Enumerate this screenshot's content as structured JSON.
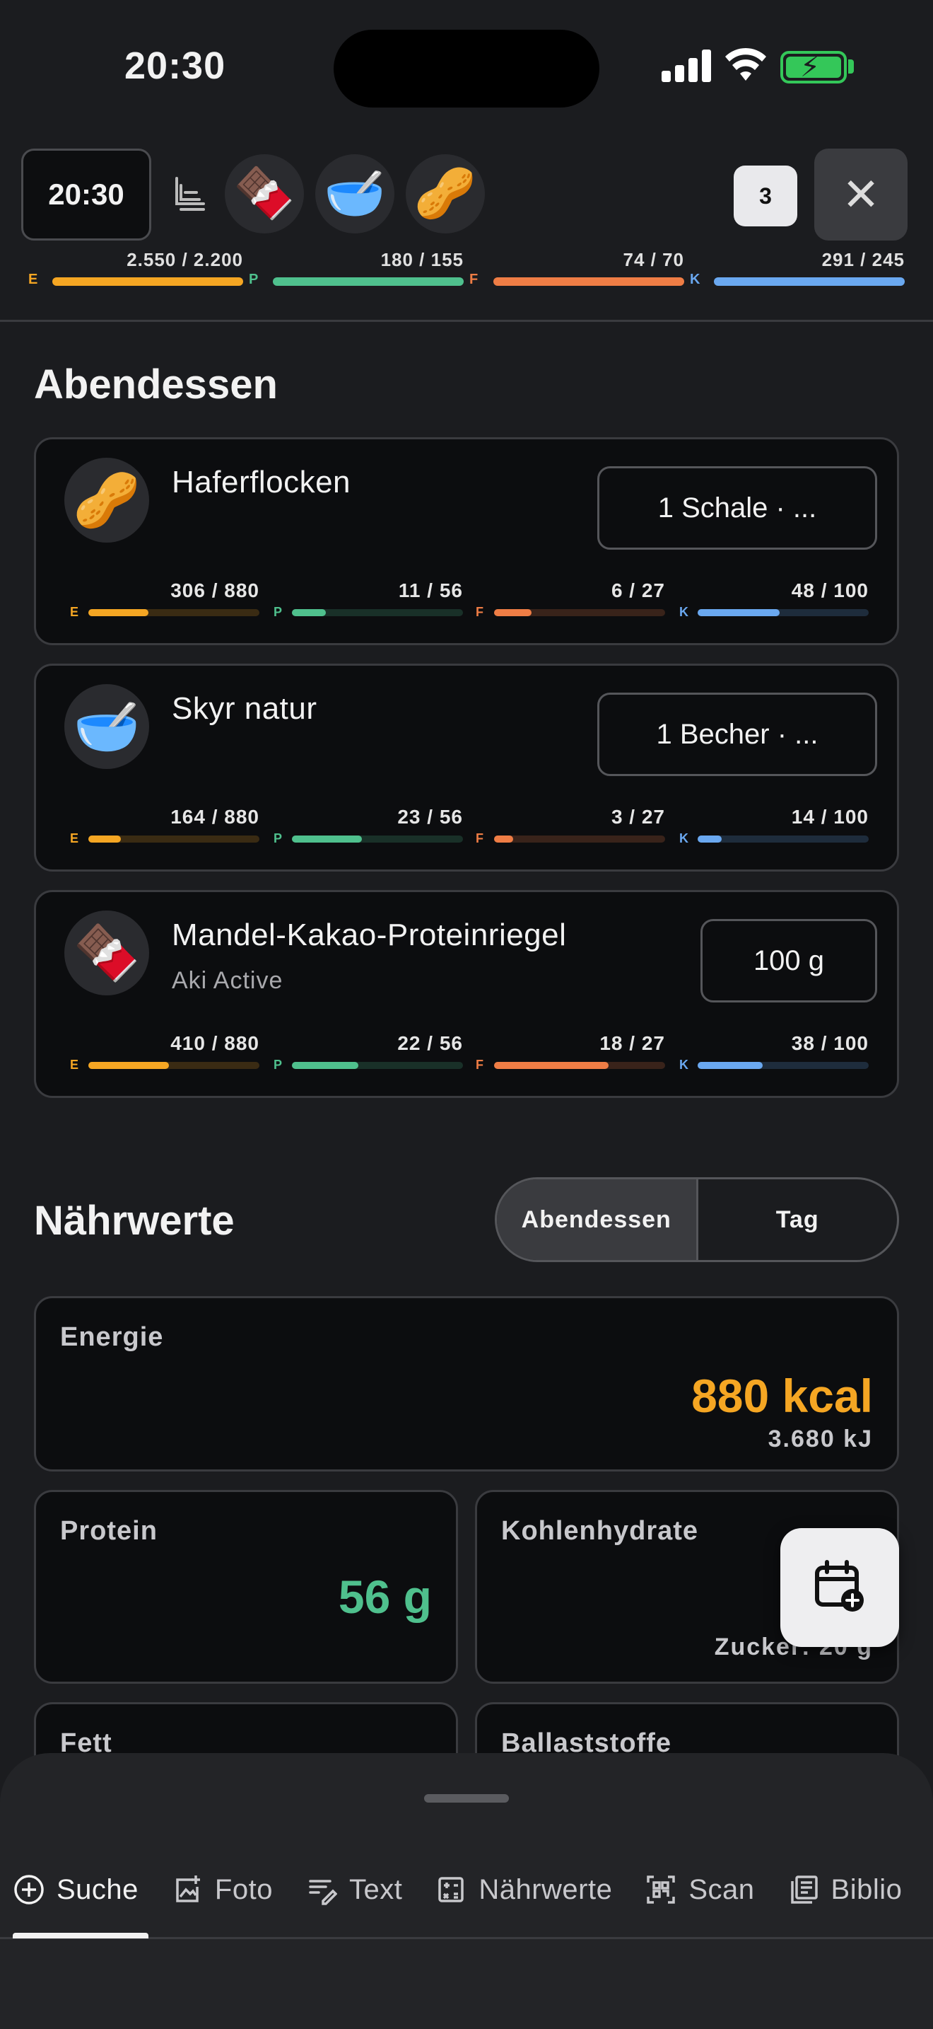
{
  "status_bar": {
    "time": "20:30"
  },
  "header": {
    "time_chip": "20:30",
    "item_count": "3",
    "thumbs": [
      "🍫",
      "🥣",
      "🥜"
    ],
    "bars": [
      {
        "letter": "E",
        "value": "2.550 / 2.200",
        "fraction": 1.0,
        "color": "#f5a623",
        "track": "#f5a623"
      },
      {
        "letter": "P",
        "value": "180 / 155",
        "fraction": 1.0,
        "color": "#4fc08d",
        "track": "#4fc08d"
      },
      {
        "letter": "F",
        "value": "74 / 70",
        "fraction": 1.0,
        "color": "#ef7d45",
        "track": "#ef7d45"
      },
      {
        "letter": "K",
        "value": "291 / 245",
        "fraction": 1.0,
        "color": "#6aa8f0",
        "track": "#6aa8f0"
      }
    ]
  },
  "meal": {
    "title": "Abendessen",
    "items": [
      {
        "name": "Haferflocken",
        "brand": "",
        "amount": "1 Schale · ...",
        "thumb": "🥜",
        "bars": [
          {
            "letter": "E",
            "value": "306 / 880",
            "fraction": 0.35
          },
          {
            "letter": "P",
            "value": "11 / 56",
            "fraction": 0.2
          },
          {
            "letter": "F",
            "value": "6 / 27",
            "fraction": 0.22
          },
          {
            "letter": "K",
            "value": "48 / 100",
            "fraction": 0.48
          }
        ]
      },
      {
        "name": "Skyr natur",
        "brand": "",
        "amount": "1 Becher · ...",
        "thumb": "🥣",
        "bars": [
          {
            "letter": "E",
            "value": "164 / 880",
            "fraction": 0.19
          },
          {
            "letter": "P",
            "value": "23 / 56",
            "fraction": 0.41
          },
          {
            "letter": "F",
            "value": "3 / 27",
            "fraction": 0.11
          },
          {
            "letter": "K",
            "value": "14 / 100",
            "fraction": 0.14
          }
        ]
      },
      {
        "name": "Mandel-Kakao-Proteinriegel",
        "brand": "Aki Active",
        "amount": "100 g",
        "thumb": "🍫",
        "bars": [
          {
            "letter": "E",
            "value": "410 / 880",
            "fraction": 0.47
          },
          {
            "letter": "P",
            "value": "22 / 56",
            "fraction": 0.39
          },
          {
            "letter": "F",
            "value": "18 / 27",
            "fraction": 0.67
          },
          {
            "letter": "K",
            "value": "38 / 100",
            "fraction": 0.38
          }
        ]
      }
    ]
  },
  "nutrients": {
    "title": "Nährwerte",
    "segments": [
      "Abendessen",
      "Tag"
    ],
    "energy": {
      "label": "Energie",
      "kcal": "880 kcal",
      "kj": "3.680 kJ"
    },
    "protein": {
      "label": "Protein",
      "value": "56 g"
    },
    "carbs": {
      "label": "Kohlenhydrate",
      "value": "10",
      "sub": "Zucker: 20 g"
    },
    "fat": {
      "label": "Fett"
    },
    "fiber": {
      "label": "Ballaststoffe"
    }
  },
  "colors": {
    "energy": "#f5a623",
    "protein": "#4fc08d",
    "fat": "#ef7d45",
    "carbs": "#6aa8f0"
  },
  "tabs": [
    {
      "label": "Suche",
      "icon": "plus-circle-icon"
    },
    {
      "label": "Foto",
      "icon": "photo-add-icon"
    },
    {
      "label": "Text",
      "icon": "text-edit-icon"
    },
    {
      "label": "Nährwerte",
      "icon": "calculator-icon"
    },
    {
      "label": "Scan",
      "icon": "barcode-scan-icon"
    },
    {
      "label": "Biblio",
      "icon": "library-icon"
    }
  ]
}
